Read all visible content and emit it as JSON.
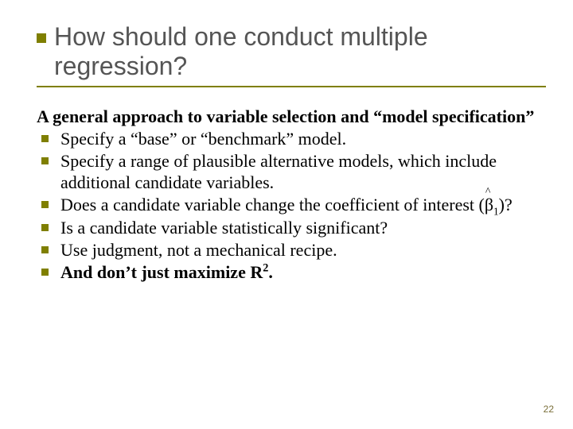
{
  "title": "How should one conduct multiple regression?",
  "lead": "A general approach to variable selection and “model specification”",
  "bullets": [
    {
      "text": "Specify a “base” or “benchmark” model."
    },
    {
      "text": "Specify a range of plausible alternative models, which include additional candidate variables."
    },
    {
      "prefix": "Does a candidate variable change the coefficient of interest (",
      "beta": "β",
      "betasub": "1",
      "suffix": ")?"
    },
    {
      "text": "Is a candidate variable statistically significant?"
    },
    {
      "text": "Use judgment, not a mechanical recipe."
    },
    {
      "prefix_bold": "And don’t just maximize R",
      "sup": "2",
      "suffix_bold": "."
    }
  ],
  "page": "22"
}
